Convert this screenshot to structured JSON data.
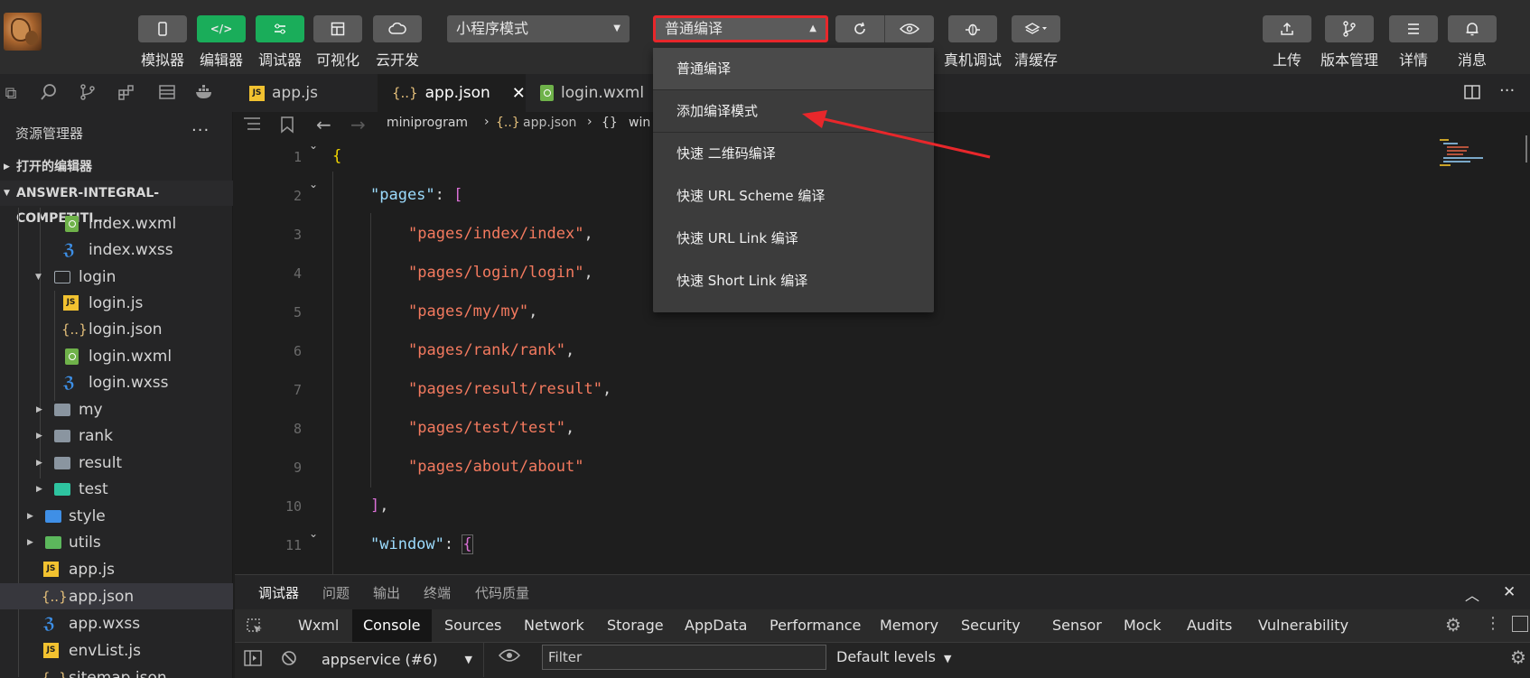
{
  "toolbar": {
    "buttons": [
      {
        "label": "模拟器",
        "icon": "phone-icon"
      },
      {
        "label": "编辑器",
        "icon": "code-icon"
      },
      {
        "label": "调试器",
        "icon": "sliders-icon"
      },
      {
        "label": "可视化",
        "icon": "layout-icon"
      },
      {
        "label": "云开发",
        "icon": "cloud-icon"
      }
    ],
    "mode_select": "小程序模式",
    "compile_select": "普通编译",
    "right_buttons": [
      {
        "label": "真机调试",
        "icon": "bug-icon"
      },
      {
        "label": "清缓存",
        "icon": "layers-icon"
      },
      {
        "label": "上传",
        "icon": "upload-icon"
      },
      {
        "label": "版本管理",
        "icon": "branch-icon"
      },
      {
        "label": "详情",
        "icon": "menu-icon"
      },
      {
        "label": "消息",
        "icon": "bell-icon"
      }
    ],
    "accent_green": "#1aad5a",
    "highlight_red": "#e8272b"
  },
  "compile_menu": {
    "items": [
      "普通编译",
      "添加编译模式",
      "快速 二维码编译",
      "快速 URL Scheme 编译",
      "快速 URL Link 编译",
      "快速 Short Link 编译"
    ]
  },
  "tabs": [
    {
      "label": "app.js",
      "type": "js"
    },
    {
      "label": "app.json",
      "type": "json",
      "active": true
    },
    {
      "label": "login.wxml",
      "type": "wxml"
    }
  ],
  "sidebar": {
    "title": "资源管理器",
    "more": "···",
    "open_editors": "打开的编辑器",
    "project": "ANSWER-INTEGRAL-COMPETITI...",
    "files": [
      {
        "label": "index.wxml",
        "type": "wxml"
      },
      {
        "label": "index.wxss",
        "type": "wxss"
      },
      {
        "label": "login",
        "type": "folder-open"
      },
      {
        "label": "login.js",
        "type": "js"
      },
      {
        "label": "login.json",
        "type": "json"
      },
      {
        "label": "login.wxml",
        "type": "wxml"
      },
      {
        "label": "login.wxss",
        "type": "wxss"
      },
      {
        "label": "my",
        "type": "folder"
      },
      {
        "label": "rank",
        "type": "folder"
      },
      {
        "label": "result",
        "type": "folder"
      },
      {
        "label": "test",
        "type": "folder-test"
      },
      {
        "label": "style",
        "type": "folder-blue"
      },
      {
        "label": "utils",
        "type": "folder-green"
      },
      {
        "label": "app.js",
        "type": "js"
      },
      {
        "label": "app.json",
        "type": "json"
      },
      {
        "label": "app.wxss",
        "type": "wxss"
      },
      {
        "label": "envList.js",
        "type": "js"
      },
      {
        "label": "sitemap.json",
        "type": "json"
      }
    ]
  },
  "breadcrumb": {
    "folder": "miniprogram",
    "file": "app.json",
    "symbol": "win"
  },
  "editor": {
    "line_numbers": [
      "1",
      "2",
      "3",
      "4",
      "5",
      "6",
      "7",
      "8",
      "9",
      "10",
      "11"
    ],
    "pages_key": "\"pages\"",
    "window_key": "\"window\"",
    "pages": [
      "\"pages/index/index\"",
      "\"pages/login/login\"",
      "\"pages/my/my\"",
      "\"pages/rank/rank\"",
      "\"pages/result/result\"",
      "\"pages/test/test\"",
      "\"pages/about/about\""
    ]
  },
  "debug": {
    "tabs": [
      "调试器",
      "问题",
      "输出",
      "终端",
      "代码质量"
    ],
    "devtools_tabs": [
      "Wxml",
      "Console",
      "Sources",
      "Network",
      "Storage",
      "AppData",
      "Performance",
      "Memory",
      "Security",
      "Sensor",
      "Mock",
      "Audits",
      "Vulnerability"
    ],
    "context_select": "appservice (#6)",
    "filter_placeholder": "Filter",
    "levels": "Default levels"
  }
}
